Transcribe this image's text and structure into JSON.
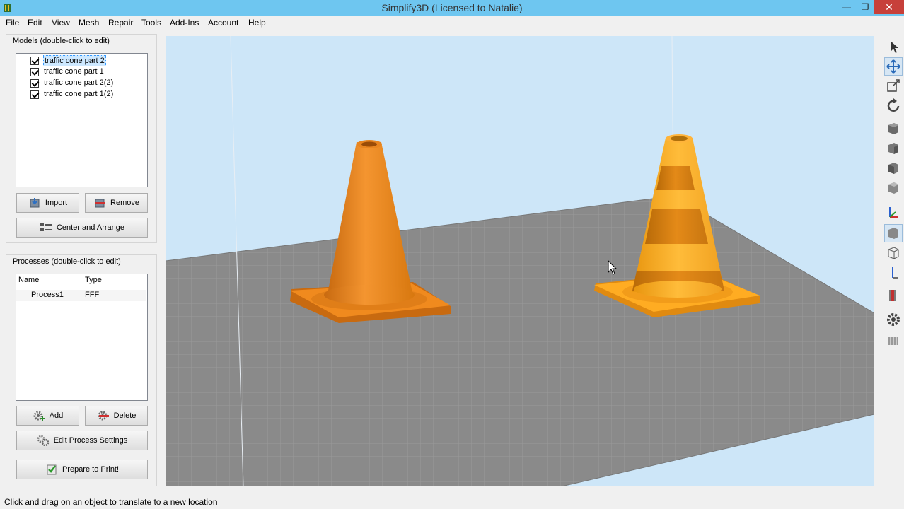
{
  "window": {
    "title": "Simplify3D (Licensed to Natalie)",
    "minimize_glyph": "—",
    "maximize_glyph": "❐",
    "close_glyph": "✕"
  },
  "menu": {
    "items": [
      "File",
      "Edit",
      "View",
      "Mesh",
      "Repair",
      "Tools",
      "Add-Ins",
      "Account",
      "Help"
    ]
  },
  "models_panel": {
    "label": "Models (double-click to edit)",
    "items": [
      {
        "label": "traffic cone part 2",
        "checked": true,
        "selected": true
      },
      {
        "label": "traffic cone part 1",
        "checked": true,
        "selected": false
      },
      {
        "label": "traffic cone part 2(2)",
        "checked": true,
        "selected": false
      },
      {
        "label": "traffic cone part 1(2)",
        "checked": true,
        "selected": false
      }
    ],
    "import_label": "Import",
    "remove_label": "Remove",
    "center_arrange_label": "Center and Arrange"
  },
  "processes_panel": {
    "label": "Processes (double-click to edit)",
    "columns": [
      "Name",
      "Type"
    ],
    "rows": [
      {
        "name": "Process1",
        "type": "FFF"
      }
    ],
    "add_label": "Add",
    "delete_label": "Delete",
    "edit_settings_label": "Edit Process Settings",
    "prepare_label": "Prepare to Print!"
  },
  "right_toolbar": {
    "tools": [
      "select-icon",
      "move-icon",
      "scale-icon",
      "rotate-icon",
      "view-cube-icon",
      "front-view-icon",
      "side-view-icon",
      "top-view-icon",
      "axes-icon",
      "solid-view-icon",
      "wireframe-view-icon",
      "axis-z-icon",
      "cut-plane-icon",
      "settings-gear-icon",
      "support-icon"
    ],
    "active_tool": "move-icon"
  },
  "status": {
    "text": "Click and drag on an object to translate to a new location"
  },
  "colors": {
    "title_bar": "#6ec6f0",
    "viewport_sky": "#cde6f8",
    "build_plate": "#8a8a8a",
    "cone_left": "#f08a1e",
    "cone_right_light": "#ffad1f",
    "cone_right_dark": "#e07a10",
    "close_button": "#c7403a"
  }
}
